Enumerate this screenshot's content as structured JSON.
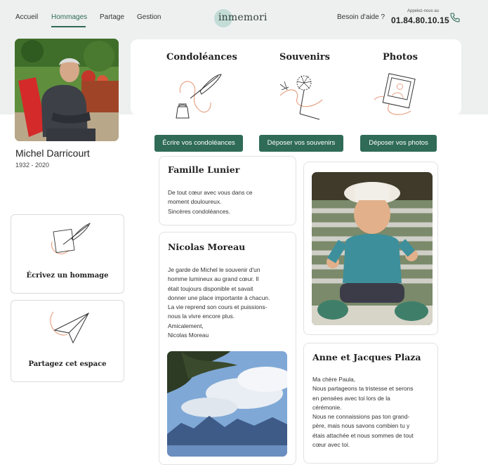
{
  "nav": {
    "items": [
      "Accueil",
      "Hommages",
      "Partage",
      "Gestion"
    ],
    "brand": "inmemori",
    "help": "Besoin d'aide ?",
    "call_label": "Appelez-nous au",
    "phone": "01.84.80.10.15"
  },
  "profile": {
    "name": "Michel Darricourt",
    "dates": "1932 - 2020"
  },
  "actions": [
    {
      "title": "Condoléances",
      "button": "Écrire vos condoléances"
    },
    {
      "title": "Souvenirs",
      "button": "Déposer vos souvenirs"
    },
    {
      "title": "Photos",
      "button": "Déposer vos photos"
    }
  ],
  "side": {
    "homage": "Écrivez un hommage",
    "share": "Partagez cet espace"
  },
  "posts": [
    {
      "author": "Famille Lunier",
      "text": "De tout cœur avec vous dans ce\nmoment douloureux.\nSincères condoléances."
    },
    {
      "author": "Nicolas Moreau",
      "text": "Je garde de Michel le souvenir d'un\nhomme lumineux au grand cœur. Il\nétait toujours disponible et savait\ndonner une place importante à chacun.\nLa vie reprend son cours et puissions-\nnous la vivre encore plus.\nAmicalement,\nNicolas Moreau"
    },
    {
      "author": "Anne et Jacques Plaza",
      "text": "Ma chère Paula,\nNous partageons ta tristesse et serons\nen pensées avec toi lors de la\ncérémonie.\nNous ne connaissions pas ton grand-\npère, mais nous savons combien tu y\nétais attachée et nous sommes de tout\ncœur avec toi."
    }
  ],
  "colors": {
    "accent": "#2f6b57",
    "band": "#eef0f0",
    "sketch": "#e8a58a"
  }
}
